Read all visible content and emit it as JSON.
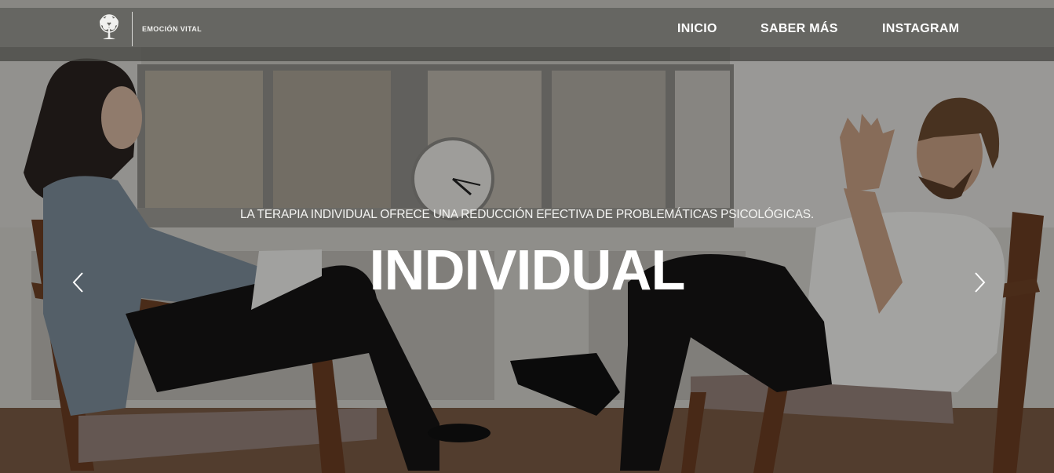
{
  "brand": {
    "name": "EMOCIÓN VITAL",
    "logo_icon": "tree-icon"
  },
  "nav": {
    "items": [
      {
        "label": "INICIO"
      },
      {
        "label": "SABER MÁS"
      },
      {
        "label": "INSTAGRAM"
      }
    ]
  },
  "hero": {
    "subtitle": "LA TERAPIA INDIVIDUAL OFRECE UNA REDUCCIÓN EFECTIVA DE PROBLEMÁTICAS PSICOLÓGICAS.",
    "title": "INDIVIDUAL",
    "prev_icon": "chevron-left-icon",
    "next_icon": "chevron-right-icon"
  },
  "colors": {
    "navbar": "#5f5f5a",
    "text": "#ffffff",
    "overlay": "#000000"
  }
}
